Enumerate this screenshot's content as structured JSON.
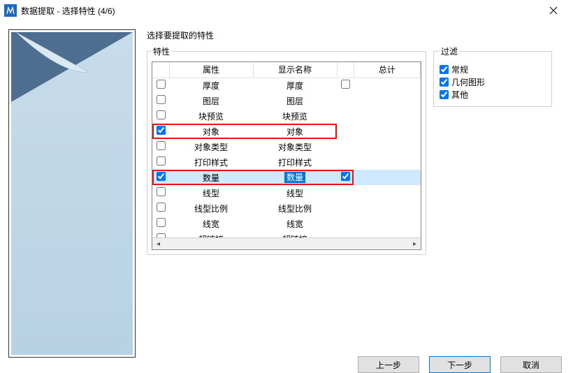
{
  "title": "数据提取 - 选择特性 (4/6)",
  "prompt": "选择要提取的特性",
  "props_legend": "特性",
  "filter_legend": "过滤",
  "columns": {
    "c0": "",
    "c1": "属性",
    "c2": "显示名称",
    "c3": "",
    "c4": "总计"
  },
  "rows": [
    {
      "checked": false,
      "attr": "厚度",
      "display": "厚度",
      "tot_chk": false,
      "tot_show": true
    },
    {
      "checked": false,
      "attr": "图层",
      "display": "图层",
      "tot_chk": false,
      "tot_show": false
    },
    {
      "checked": false,
      "attr": "块预览",
      "display": "块预览",
      "tot_chk": false,
      "tot_show": false
    },
    {
      "checked": true,
      "attr": "对象",
      "display": "对象",
      "tot_chk": false,
      "tot_show": false,
      "redbox": true
    },
    {
      "checked": false,
      "attr": "对象类型",
      "display": "对象类型",
      "tot_chk": false,
      "tot_show": false
    },
    {
      "checked": false,
      "attr": "打印样式",
      "display": "打印样式",
      "tot_chk": false,
      "tot_show": false
    },
    {
      "checked": true,
      "attr": "数量",
      "display": "数量",
      "tot_chk": true,
      "tot_show": true,
      "selected": true,
      "hl_display": true,
      "redbox": true,
      "redbox_wide": true
    },
    {
      "checked": false,
      "attr": "线型",
      "display": "线型",
      "tot_chk": false,
      "tot_show": false
    },
    {
      "checked": false,
      "attr": "线型比例",
      "display": "线型比例",
      "tot_chk": false,
      "tot_show": false
    },
    {
      "checked": false,
      "attr": "线宽",
      "display": "线宽",
      "tot_chk": false,
      "tot_show": false
    },
    {
      "checked": false,
      "attr": "超链接",
      "display": "超链接",
      "tot_chk": false,
      "tot_show": false
    }
  ],
  "filters": [
    {
      "label": "常规",
      "checked": true
    },
    {
      "label": "几何图形",
      "checked": true
    },
    {
      "label": "其他",
      "checked": true
    }
  ],
  "buttons": {
    "back": "上一步",
    "next": "下一步",
    "cancel": "取消"
  }
}
